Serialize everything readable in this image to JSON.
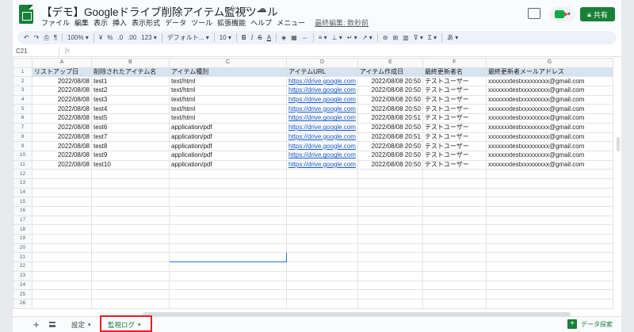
{
  "header": {
    "title": "【デモ】Googleドライブ削除アイテム監視ツール",
    "menu": [
      "ファイル",
      "編集",
      "表示",
      "挿入",
      "表示形式",
      "データ",
      "ツール",
      "拡張機能",
      "ヘルプ",
      "メニュー"
    ],
    "last_edit": "最終編集: 数秒前",
    "share_label": "共有"
  },
  "toolbar": {
    "zoom": "100%",
    "currency": "¥",
    "percent": "%",
    "dec_less": ".0",
    "dec_more": ".00",
    "num_format": "123",
    "font": "デフォルト...",
    "font_size": "10",
    "bold": "B",
    "italic": "I",
    "strike": "S",
    "text_color": "A",
    "input_tools": "あ"
  },
  "formula_bar": {
    "name_box": "C21",
    "fx": "fx"
  },
  "grid": {
    "columns": [
      "A",
      "B",
      "C",
      "D",
      "E",
      "F",
      "G"
    ],
    "header_row": [
      "リストアップ日",
      "削除されたアイテム名",
      "アイテム種別",
      "アイテムURL",
      "アイテム作成日",
      "最終更新者名",
      "最終更新者メールアドレス"
    ],
    "rows": [
      [
        "2022/08/08",
        "test1",
        "text/html",
        "https://drive.google.com",
        "2022/08/08 20:50",
        "テストユーザー",
        "xxxxxxxtestxxxxxxxxx@gmail.com"
      ],
      [
        "2022/08/08",
        "test2",
        "text/html",
        "https://drive.google.com",
        "2022/08/08 20:50",
        "テストユーザー",
        "xxxxxxxtestxxxxxxxxx@gmail.com"
      ],
      [
        "2022/08/08",
        "test3",
        "text/html",
        "https://drive.google.com",
        "2022/08/08 20:50",
        "テストユーザー",
        "xxxxxxxtestxxxxxxxxx@gmail.com"
      ],
      [
        "2022/08/08",
        "test4",
        "text/html",
        "https://drive.google.com",
        "2022/08/08 20:50",
        "テストユーザー",
        "xxxxxxxtestxxxxxxxxx@gmail.com"
      ],
      [
        "2022/08/08",
        "test5",
        "text/html",
        "https://drive.google.com",
        "2022/08/08 20:51",
        "テストユーザー",
        "xxxxxxxtestxxxxxxxxx@gmail.com"
      ],
      [
        "2022/08/08",
        "test6",
        "application/pdf",
        "https://drive.google.com",
        "2022/08/08 20:50",
        "テストユーザー",
        "xxxxxxxtestxxxxxxxxx@gmail.com"
      ],
      [
        "2022/08/08",
        "test7",
        "application/pdf",
        "https://drive.google.com",
        "2022/08/08 20:51",
        "テストユーザー",
        "xxxxxxxtestxxxxxxxxx@gmail.com"
      ],
      [
        "2022/08/08",
        "test8",
        "application/pdf",
        "https://drive.google.com",
        "2022/08/08 20:50",
        "テストユーザー",
        "xxxxxxxtestxxxxxxxxx@gmail.com"
      ],
      [
        "2022/08/08",
        "test9",
        "application/pdf",
        "https://drive.google.com",
        "2022/08/08 20:50",
        "テストユーザー",
        "xxxxxxxtestxxxxxxxxx@gmail.com"
      ],
      [
        "2022/08/08",
        "test10",
        "application/pdf",
        "https://drive.google.com",
        "2022/08/08 20:50",
        "テストユーザー",
        "xxxxxxxtestxxxxxxxxx@gmail.com"
      ]
    ],
    "row_count": 26,
    "selected_row": 21,
    "selected_col": 2
  },
  "sheets": {
    "tabs": [
      "設定",
      "監視ログ"
    ],
    "active": 1,
    "explore_label": "データ探索"
  },
  "colors": {
    "brand_green": "#188038",
    "header_fill": "#d6e3f0",
    "link": "#1155cc",
    "highlight_box": "#ea1c24"
  }
}
